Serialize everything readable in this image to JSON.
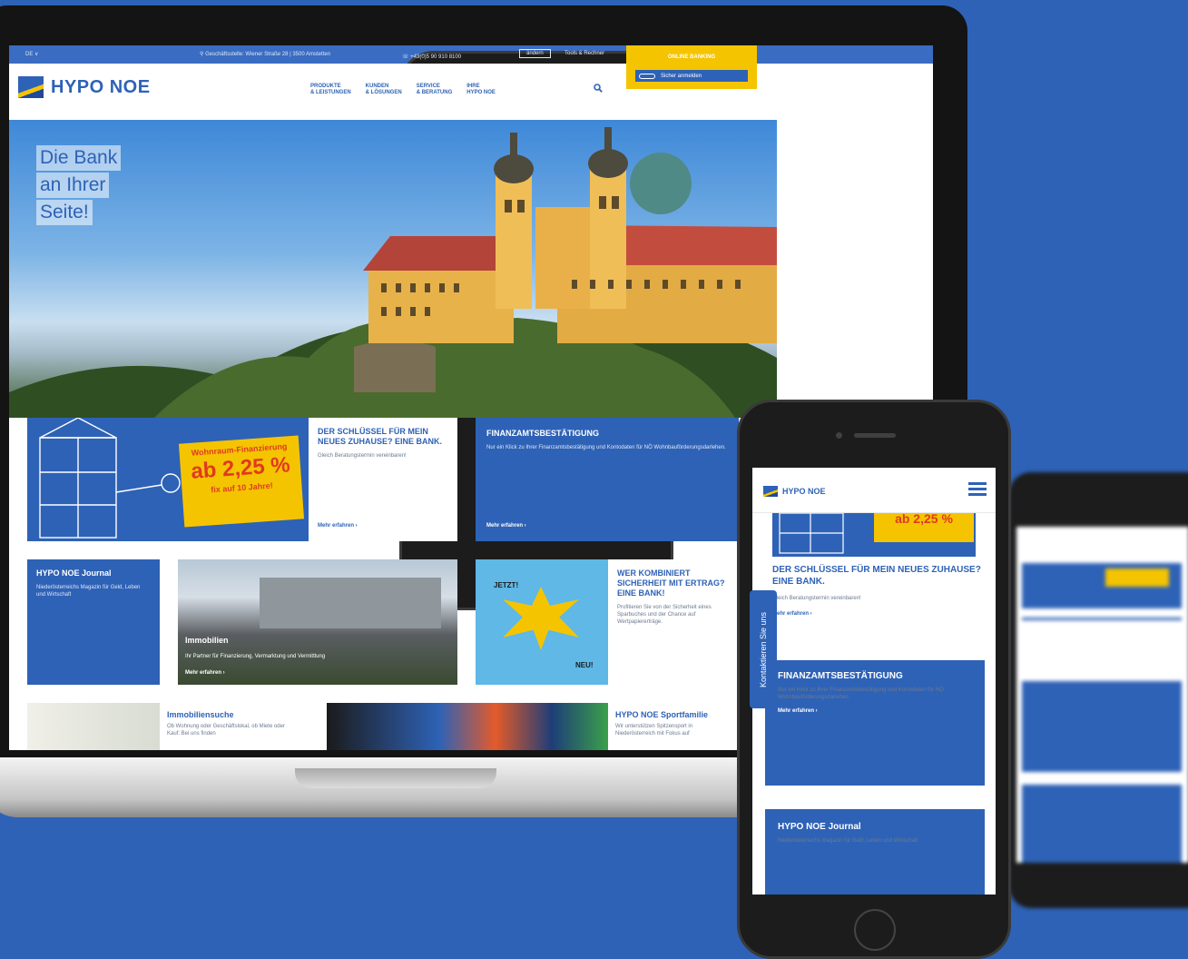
{
  "colors": {
    "brand_blue": "#2e62b6",
    "brand_yellow": "#f5c400",
    "white": "#ffffff"
  },
  "laptop": {
    "topbar": {
      "language": "DE ∨",
      "address": "Geschäftsstelle: Wiener Straße 28 | 3500 Amstetten",
      "phone": "+43(0)5 90 910 8100",
      "change_label": "ändern",
      "tools_label": "Tools & Rechner"
    },
    "online_banking": {
      "title": "ONLINE BANKING",
      "login_label": "Sicher anmelden"
    },
    "header": {
      "logo_text": "HYPO NOE",
      "nav": [
        "PRODUKTE\n& LEISTUNGEN",
        "KUNDEN\n& LÖSUNGEN",
        "SERVICE\n& BERATUNG",
        "IHRE\nHYPO NOE"
      ],
      "search_icon": "search-icon"
    },
    "hero": {
      "slogan_lines": [
        "Die Bank",
        "an Ihrer",
        "Seite!"
      ]
    },
    "tiles": {
      "promo_badge_line1": "Wohnraum-Finanzierung",
      "promo_badge_line2": "ab 2,25 %",
      "promo_badge_line3": "fix auf 10 Jahre!",
      "key_title": "DER SCHLÜSSEL FÜR MEIN NEUES ZUHAUSE? EINE BANK.",
      "key_text": "Gleich Beratungstermin vereinbaren!",
      "key_link": "Mehr erfahren ›",
      "finanzamt_title": "FINANZAMTSBESTÄTIGUNG",
      "finanzamt_text": "Nur ein Klick zu Ihrer Finanzamtsbestätigung und Kontodaten für NÖ Wohnbauförderungsdarlehen.",
      "finanzamt_link": "Mehr erfahren ›",
      "journal_title": "HYPO NOE Journal",
      "journal_text": "Niederösterreichs Magazin für Geld, Leben und Wirtschaft",
      "immo_title": "Immobilien",
      "immo_text": "Ihr Partner für Finanzierung, Vermarktung und Vermittlung",
      "immo_link": "Mehr erfahren ›",
      "ertrag_title": "WER KOMBINIERT SICHERHEIT MIT ERTRAG? EINE BANK!",
      "ertrag_text": "Profitieren Sie von der Sicherheit eines Sparbuches und der Chance auf Wertpapiererträge.",
      "jetzt_label": "JETZT!",
      "neu_label": "NEU!",
      "immosuche_title": "Immobiliensuche",
      "immosuche_text": "Ob Wohnung oder Geschäftslokal, ob Miete oder Kauf: Bei uns finden",
      "sport_title": "HYPO NOE Sportfamilie",
      "sport_text": "Wir unterstützen Spitzensport in Niederösterreich mit Fokus auf"
    }
  },
  "phone": {
    "logo_text": "HYPO NOE",
    "hero_badge": "ab 2,25 %",
    "key_title": "DER SCHLÜSSEL FÜR MEIN NEUES ZUHAUSE? EINE BANK.",
    "key_text": "Gleich Beratungstermin vereinbaren!",
    "key_link": "Mehr erfahren ›",
    "finanzamt_title": "FINANZAMTSBESTÄTIGUNG",
    "finanzamt_text": "Nur ein Klick zu Ihrer Finanzamtsbestätigung und Kontodaten für NÖ Wohnbauförderungsdarlehen.",
    "finanzamt_link": "Mehr erfahren ›",
    "journal_title": "HYPO NOE Journal",
    "journal_text": "Niederösterreichs Magazin für Geld, Leben und Wirtschaft",
    "contact_tab": "Kontaktieren Sie uns"
  }
}
